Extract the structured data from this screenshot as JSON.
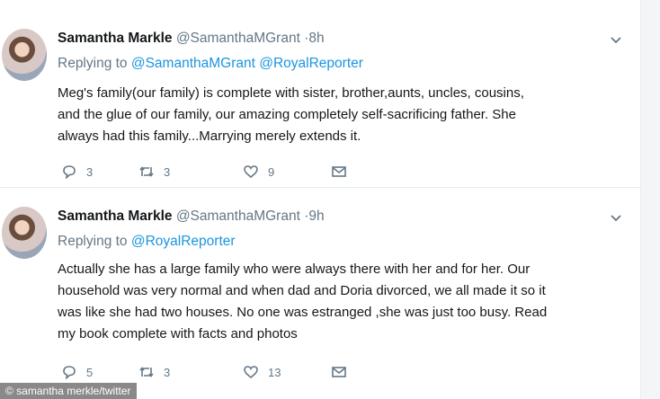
{
  "tweets": [
    {
      "name": "Samantha Markle",
      "handle": "@SamanthaMGrant",
      "time": "·8h",
      "replying_prefix": "Replying to ",
      "replying_to": "@SamanthaMGrant @RoyalReporter",
      "lines": [
        "Meg's family(our family) is complete with  sister, brother,aunts, uncles, cousins,",
        "and the glue of our family, our amazing completely self-sacrificing father. She",
        "always had this family...Marrying merely extends it."
      ],
      "replies": "3",
      "retweets": "3",
      "likes": "9"
    },
    {
      "name": "Samantha Markle",
      "handle": "@SamanthaMGrant",
      "time": "·9h",
      "replying_prefix": "Replying to ",
      "replying_to": "@RoyalReporter",
      "lines": [
        "Actually she has a large family who were always there with her and for her. Our",
        "household was very normal and when dad and Doria divorced, we all made it so it",
        "was like she had two houses. No one was estranged ,she was just too busy. Read",
        "my book complete with facts and photos"
      ],
      "replies": "5",
      "retweets": "3",
      "likes": "13"
    }
  ],
  "watermark": "© samantha merkle/twitter",
  "icons": {
    "reply": "reply-icon",
    "retweet": "retweet-icon",
    "like": "heart-icon",
    "message": "envelope-icon",
    "menu": "chevron-down-icon"
  },
  "colors": {
    "name": "#14171a",
    "secondary": "#657786",
    "link": "#1b95e0",
    "divider": "#e6ecf0"
  }
}
